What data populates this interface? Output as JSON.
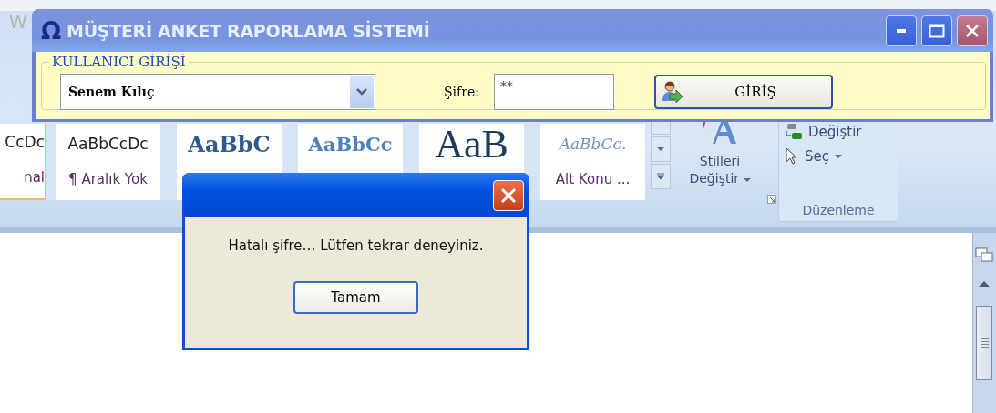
{
  "background_app": {
    "title_fragment": "W",
    "style_gallery": [
      {
        "preview": "CcDc",
        "label": "nal",
        "kind": "sans",
        "selected": true
      },
      {
        "preview": "AaBbCcDc",
        "label": "¶ Aralık Yok",
        "kind": "sans",
        "selected": false
      },
      {
        "preview": "AaBbC",
        "kind": "heading",
        "selected": false
      },
      {
        "preview": "AaBbCc",
        "kind": "subheading",
        "selected": false
      },
      {
        "preview": "AaB",
        "kind": "title",
        "selected": false
      },
      {
        "preview": "AaBbCc.",
        "label": "Alt Konu ...",
        "kind": "italic",
        "selected": false
      }
    ],
    "change_styles": {
      "label": "Stilleri Değiştir"
    },
    "editing_group": {
      "label": "Düzenleme",
      "items": [
        {
          "label": "Değiştir",
          "kind": "replace"
        },
        {
          "label": "Seç",
          "kind": "select"
        }
      ]
    }
  },
  "login_window": {
    "logo": "Ω",
    "title": "MÜŞTERİ ANKET RAPORLAMA SİSTEMİ",
    "group_label": "KULLANICI GİRİŞİ",
    "user": {
      "value": "Senem Kılıç"
    },
    "password": {
      "label": "Şifre:",
      "value": "**"
    },
    "login_button": "GİRİŞ"
  },
  "message_box": {
    "message": "Hatalı şifre… Lütfen tekrar deneyiniz.",
    "button": "Tamam"
  }
}
